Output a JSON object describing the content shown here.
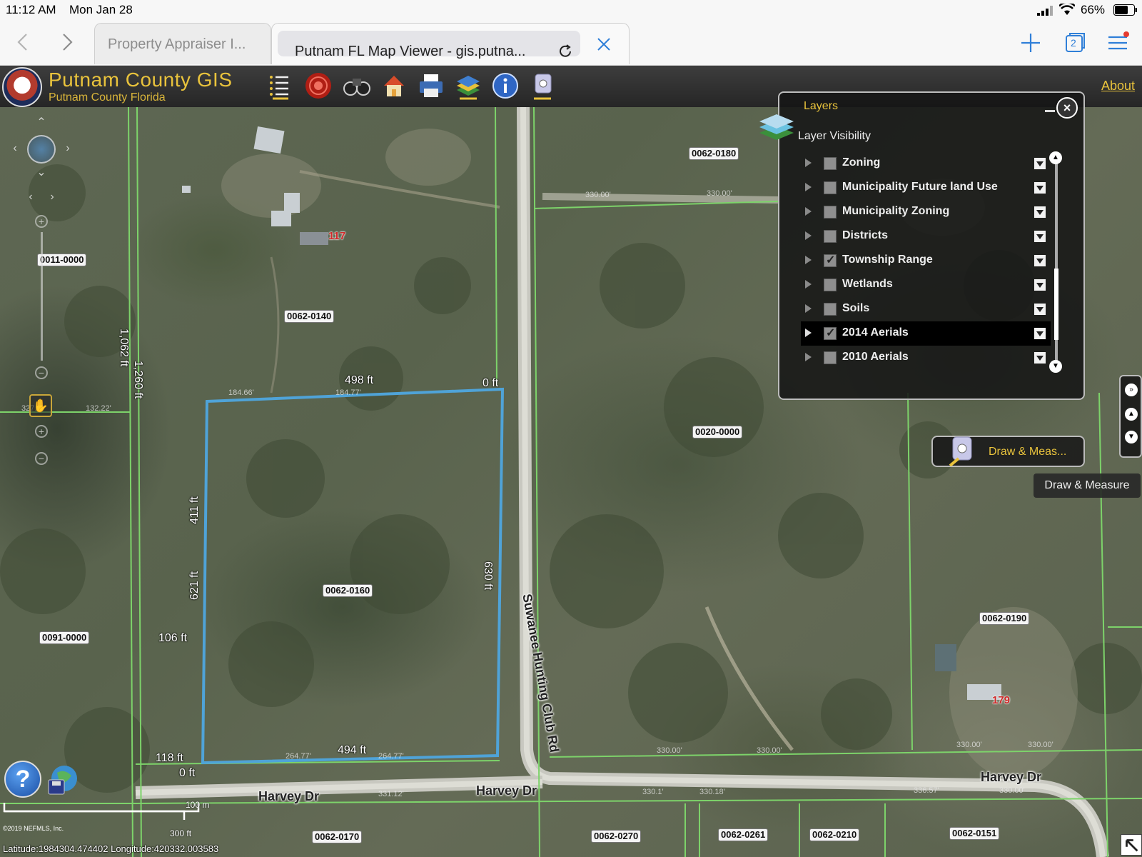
{
  "status_bar": {
    "time": "11:12 AM",
    "date": "Mon Jan 28",
    "battery": "66%"
  },
  "browser": {
    "tabs": [
      {
        "label": "Property Appraiser I...",
        "active": false
      },
      {
        "label": "Putnam FL Map Viewer - gis.putna...",
        "active": true
      }
    ],
    "tab_count": "2"
  },
  "app": {
    "title": "Putnam County GIS",
    "subtitle": "Putnam County Florida",
    "about_label": "About",
    "toolbar_icons": [
      "list-icon",
      "target-icon",
      "binoculars-icon",
      "home-icon",
      "printer-icon",
      "layers-icon",
      "info-icon",
      "measure-icon"
    ]
  },
  "layers_panel": {
    "title": "Layers",
    "subtitle": "Layer Visibility",
    "layers": [
      {
        "name": "Zoning",
        "checked": false,
        "selected": false
      },
      {
        "name": "Municipality Future land Use",
        "checked": false,
        "selected": false
      },
      {
        "name": "Municipality Zoning",
        "checked": false,
        "selected": false
      },
      {
        "name": "Districts",
        "checked": false,
        "selected": false
      },
      {
        "name": "Township Range",
        "checked": true,
        "selected": false
      },
      {
        "name": "Wetlands",
        "checked": false,
        "selected": false
      },
      {
        "name": "Soils",
        "checked": false,
        "selected": false
      },
      {
        "name": "2014 Aerials",
        "checked": true,
        "selected": true
      },
      {
        "name": "2010 Aerials",
        "checked": false,
        "selected": false
      }
    ]
  },
  "draw_measure": {
    "button_label": "Draw & Meas...",
    "tooltip": "Draw & Measure"
  },
  "map": {
    "parcels": [
      "0062-0180",
      "0011-0000",
      "0062-0140",
      "0020-0000",
      "0062-0160",
      "0091-0000",
      "0062-0190",
      "0062-0170",
      "0062-0270",
      "0062-0261",
      "0062-0210",
      "0062-0151"
    ],
    "house_numbers": [
      "117",
      "179"
    ],
    "dimensions": [
      "498 ft",
      "0 ft",
      "1,062 ft",
      "1,260 ft",
      "411 ft",
      "621 ft",
      "630 ft",
      "106 ft",
      "118 ft",
      "0 ft",
      "494 ft"
    ],
    "roads": [
      "Suwanee Hunting Club Rd",
      "Harvey Dr",
      "Harvey Dr",
      "Harvey Dr"
    ],
    "scale_top": "100 m",
    "scale_bottom": "300 ft",
    "copyright": "©2019 NEFMLS, Inc.",
    "coordinates": "Latitude:1984304.474402  Longitude:420332.003583"
  },
  "colors": {
    "accent": "#e9c33c",
    "parcel_highlight": "#4fa3d8",
    "parcel_lines": "#7dd36a",
    "house_number": "#d02a2a"
  }
}
